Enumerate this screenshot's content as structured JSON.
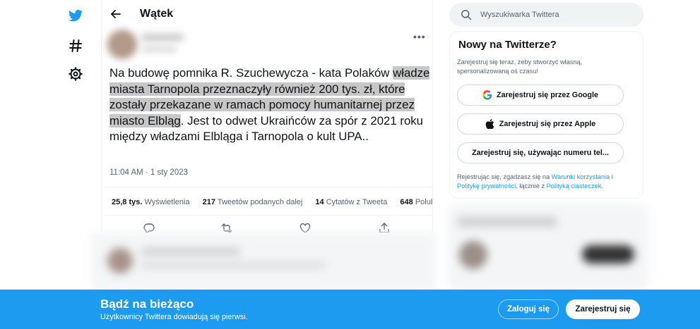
{
  "colors": {
    "accent": "#1d9bf0",
    "text": "#0f1419",
    "muted": "#536471",
    "highlight": "#c7c7c7"
  },
  "nav": {
    "icons": [
      "twitter-logo-icon",
      "explore-hashtag-icon",
      "settings-gear-icon"
    ]
  },
  "header": {
    "title": "Wątek",
    "back_icon": "back-arrow-icon"
  },
  "tweet": {
    "text_parts": [
      {
        "text": "Na budowę pomnika R. Szuchewycza - kata Polaków ",
        "highlighted": false
      },
      {
        "text": "władze miasta Tarnopola przeznaczyły również 200 tys. zł, które zostały przekazane w ramach pomocy humanitarnej przez miasto Elbląg",
        "highlighted": true
      },
      {
        "text": ". Jest to odwet Ukraińców za spór z 2021 roku między władzami Elbląga i Tarnopola o kult UPA..",
        "highlighted": false
      }
    ],
    "timestamp": "11:04 AM · 1 sty 2023",
    "stats": [
      {
        "value": "25,8 tys.",
        "label": "Wyświetlenia"
      },
      {
        "value": "217",
        "label": "Tweetów podanych dalej"
      },
      {
        "value": "14",
        "label": "Cytatów z Tweeta"
      },
      {
        "value": "648",
        "label": "Polubienia"
      }
    ],
    "actions": [
      "reply-icon",
      "retweet-icon",
      "like-icon",
      "share-icon"
    ]
  },
  "search": {
    "placeholder": "Wyszukiwarka Twittera"
  },
  "signup_card": {
    "title": "Nowy na Twitterze?",
    "description": "Zarejestruj się teraz, żeby stworzyć własną, spersonalizowaną oś czasu!",
    "buttons": [
      {
        "label": "Zarejestruj się przez Google",
        "icon": "google-icon"
      },
      {
        "label": "Zarejestruj się przez Apple",
        "icon": "apple-icon"
      },
      {
        "label": "Zarejestruj się, używając numeru tel...",
        "icon": ""
      }
    ],
    "terms": {
      "prefix": "Rejestrując się, zgadzasz się na ",
      "link1": "Warunki korzystania",
      "mid1": " i ",
      "link2": "Politykę prywatności",
      "mid2": ", łącznie z ",
      "link3": "Polityką ciasteczek",
      "suffix": "."
    }
  },
  "bottom_bar": {
    "title": "Bądź na bieżąco",
    "subtitle": "Użytkownicy Twittera dowiadują się pierwsi.",
    "login_label": "Zaloguj się",
    "signup_label": "Zarejestruj się"
  }
}
